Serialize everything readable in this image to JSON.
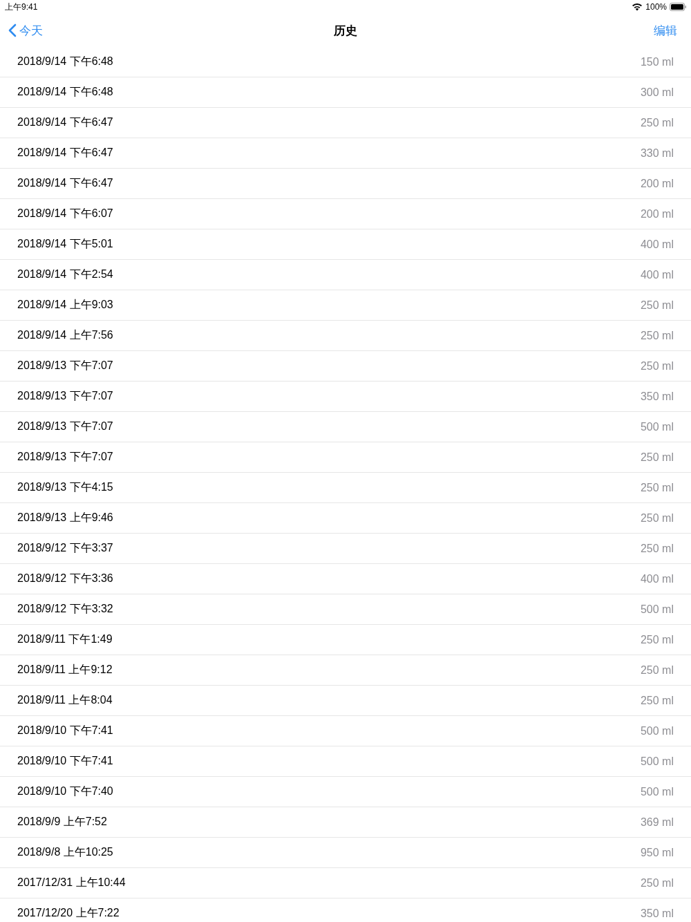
{
  "status_bar": {
    "time": "上午9:41",
    "battery": "100%"
  },
  "nav_bar": {
    "back": "今天",
    "title": "历史",
    "action": "编辑"
  },
  "rows": [
    {
      "date": "2018/9/14 下午6:48",
      "amount": "150 ml"
    },
    {
      "date": "2018/9/14 下午6:48",
      "amount": "300 ml"
    },
    {
      "date": "2018/9/14 下午6:47",
      "amount": "250 ml"
    },
    {
      "date": "2018/9/14 下午6:47",
      "amount": "330 ml"
    },
    {
      "date": "2018/9/14 下午6:47",
      "amount": "200 ml"
    },
    {
      "date": "2018/9/14 下午6:07",
      "amount": "200 ml"
    },
    {
      "date": "2018/9/14 下午5:01",
      "amount": "400 ml"
    },
    {
      "date": "2018/9/14 下午2:54",
      "amount": "400 ml"
    },
    {
      "date": "2018/9/14 上午9:03",
      "amount": "250 ml"
    },
    {
      "date": "2018/9/14 上午7:56",
      "amount": "250 ml"
    },
    {
      "date": "2018/9/13 下午7:07",
      "amount": "250 ml"
    },
    {
      "date": "2018/9/13 下午7:07",
      "amount": "350 ml"
    },
    {
      "date": "2018/9/13 下午7:07",
      "amount": "500 ml"
    },
    {
      "date": "2018/9/13 下午7:07",
      "amount": "250 ml"
    },
    {
      "date": "2018/9/13 下午4:15",
      "amount": "250 ml"
    },
    {
      "date": "2018/9/13 上午9:46",
      "amount": "250 ml"
    },
    {
      "date": "2018/9/12 下午3:37",
      "amount": "250 ml"
    },
    {
      "date": "2018/9/12 下午3:36",
      "amount": "400 ml"
    },
    {
      "date": "2018/9/12 下午3:32",
      "amount": "500 ml"
    },
    {
      "date": "2018/9/11 下午1:49",
      "amount": "250 ml"
    },
    {
      "date": "2018/9/11 上午9:12",
      "amount": "250 ml"
    },
    {
      "date": "2018/9/11 上午8:04",
      "amount": "250 ml"
    },
    {
      "date": "2018/9/10 下午7:41",
      "amount": "500 ml"
    },
    {
      "date": "2018/9/10 下午7:41",
      "amount": "500 ml"
    },
    {
      "date": "2018/9/10 下午7:40",
      "amount": "500 ml"
    },
    {
      "date": "2018/9/9 上午7:52",
      "amount": "369 ml"
    },
    {
      "date": "2018/9/8 上午10:25",
      "amount": "950 ml"
    },
    {
      "date": "2017/12/31 上午10:44",
      "amount": "250 ml"
    },
    {
      "date": "2017/12/20 上午7:22",
      "amount": "350 ml"
    }
  ]
}
